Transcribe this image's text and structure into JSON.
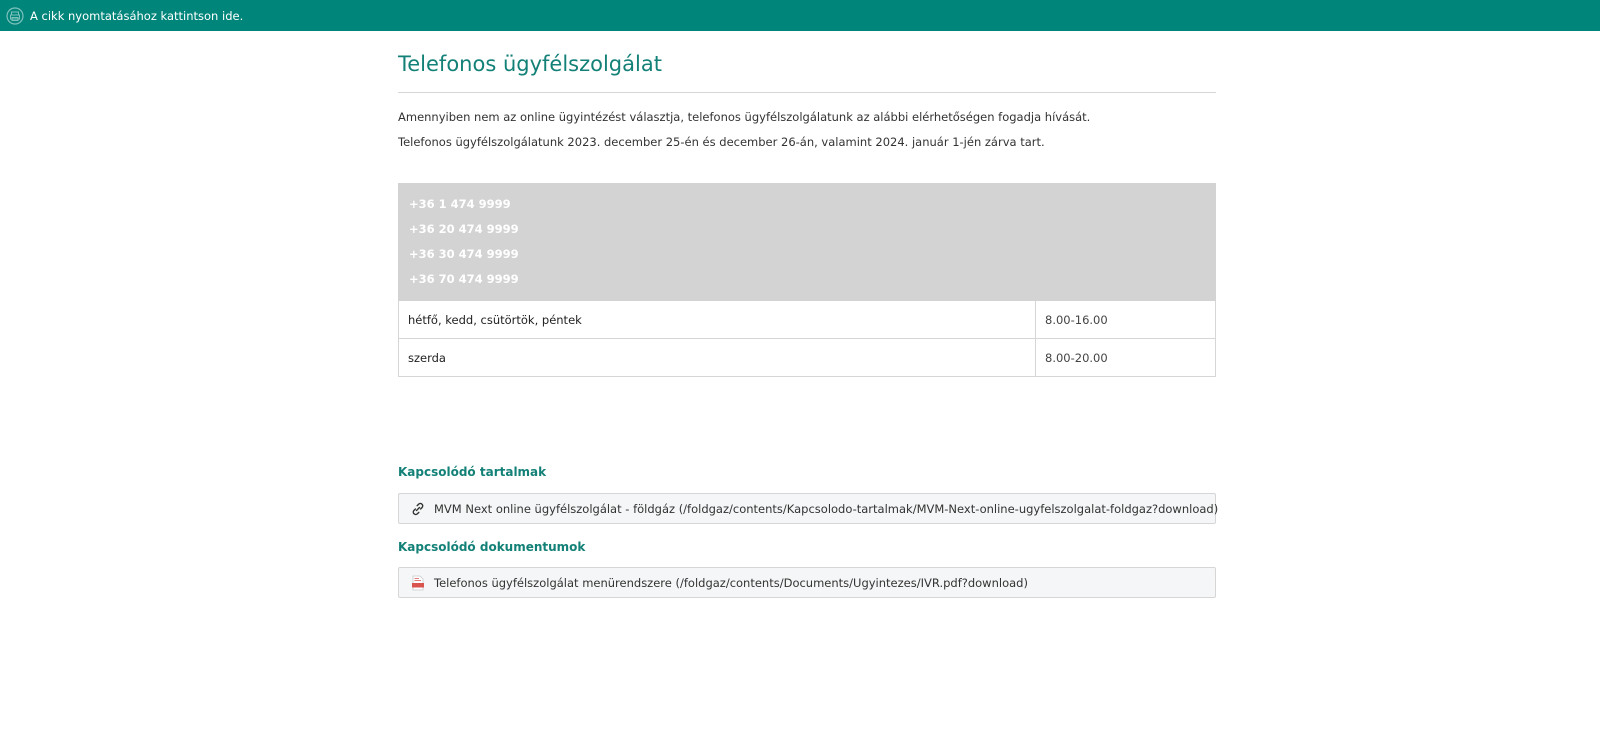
{
  "topbar": {
    "print_label": "A cikk nyomtatásához kattintson ide.",
    "print_icon": "print-icon",
    "background": "#00857a"
  },
  "page": {
    "title": "Telefonos ügyfélszolgálat",
    "intro": "Amennyiben nem az online ügyintézést választja, telefonos ügyfélszolgálatunk az alábbi elérhetőségen fogadja hívását.",
    "holiday_notice": "Telefonos ügyfélszolgálatunk 2023. december 25-én és december 26-án, valamint 2024. január 1-jén zárva tart."
  },
  "phones": [
    "+36 1 474 9999",
    "+36 20 474 9999",
    "+36 30 474 9999",
    "+36 70 474 9999"
  ],
  "hours": [
    {
      "days": "hétfő, kedd, csütörtök, péntek",
      "time": "8.00-16.00"
    },
    {
      "days": "szerda",
      "time": "8.00-20.00"
    }
  ],
  "related": {
    "heading": "Kapcsolódó tartalmak",
    "icon": "link-icon",
    "link_text": "MVM Next online ügyfélszolgálat - földgáz (/foldgaz/contents/Kapcsolodo-tartalmak/MVM-Next-online-ugyfelszolgalat-foldgaz?download)"
  },
  "documents": {
    "heading": "Kapcsolódó dokumentumok",
    "icon": "pdf-icon",
    "link_text": "Telefonos ügyfélszolgálat menürendszere (/foldgaz/contents/Documents/Ugyintezes/IVR.pdf?download)"
  },
  "colors": {
    "accent": "#138177",
    "phone_box": "#d3d3d3"
  }
}
